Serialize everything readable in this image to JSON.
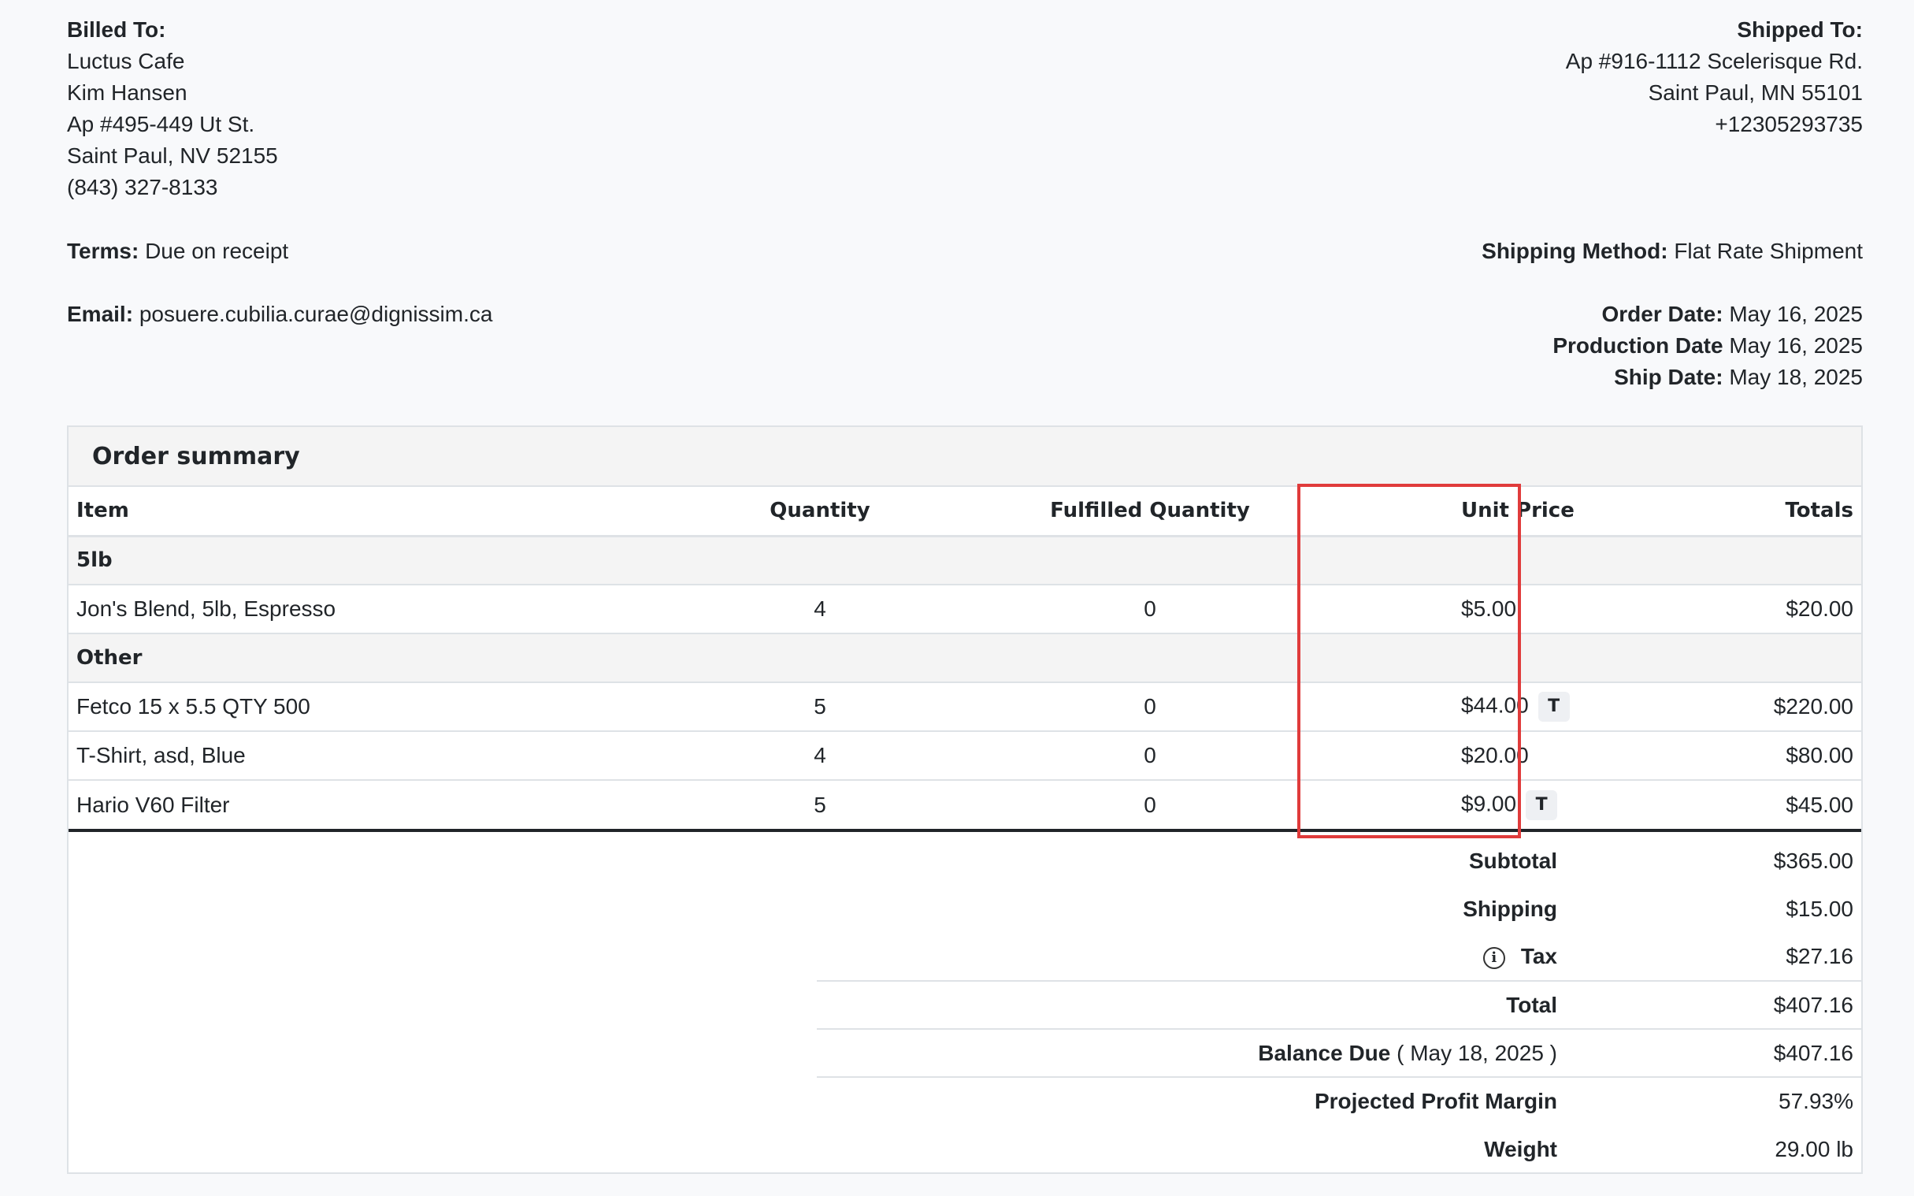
{
  "billed_to": {
    "label": "Billed To:",
    "company": "Luctus Cafe",
    "name": "Kim Hansen",
    "address1": "Ap #495-449 Ut St.",
    "address2": "Saint Paul, NV 52155",
    "phone": "(843) 327-8133"
  },
  "terms": {
    "label": "Terms:",
    "value": "Due on receipt"
  },
  "email": {
    "label": "Email:",
    "value": "posuere.cubilia.curae@dignissim.ca"
  },
  "shipped_to": {
    "label": "Shipped To:",
    "address1": "Ap #916-1112 Scelerisque Rd.",
    "address2": "Saint Paul, MN 55101",
    "phone": "+12305293735"
  },
  "shipping_method": {
    "label": "Shipping Method:",
    "value": "Flat Rate Shipment"
  },
  "dates": {
    "order": {
      "label": "Order Date:",
      "value": "May 16, 2025"
    },
    "production": {
      "label": "Production Date",
      "value": "May 16, 2025"
    },
    "ship": {
      "label": "Ship Date:",
      "value": "May 18, 2025"
    }
  },
  "summary": {
    "title": "Order summary",
    "headers": {
      "item": "Item",
      "quantity": "Quantity",
      "fulfilled": "Fulfilled Quantity",
      "unit_price": "Unit Price",
      "totals": "Totals"
    },
    "groups": [
      {
        "name": "5lb",
        "rows": [
          {
            "item": "Jon's Blend, 5lb, Espresso",
            "quantity": "4",
            "fulfilled": "0",
            "unit_price": "$5.00",
            "taxed": "",
            "total": "$20.00"
          }
        ]
      },
      {
        "name": "Other",
        "rows": [
          {
            "item": "Fetco 15 x 5.5 QTY 500",
            "quantity": "5",
            "fulfilled": "0",
            "unit_price": "$44.00",
            "taxed": "T",
            "total": "$220.00"
          },
          {
            "item": "T-Shirt, asd, Blue",
            "quantity": "4",
            "fulfilled": "0",
            "unit_price": "$20.00",
            "taxed": "",
            "total": "$80.00"
          },
          {
            "item": "Hario V60 Filter",
            "quantity": "5",
            "fulfilled": "0",
            "unit_price": "$9.00",
            "taxed": "T",
            "total": "$45.00"
          }
        ]
      }
    ],
    "totals": {
      "subtotal": {
        "label": "Subtotal",
        "value": "$365.00"
      },
      "shipping": {
        "label": "Shipping",
        "value": "$15.00"
      },
      "tax": {
        "label": "Tax",
        "value": "$27.16"
      },
      "total": {
        "label": "Total",
        "value": "$407.16"
      },
      "balance_due": {
        "label": "Balance Due",
        "date": "( May 18, 2025 )",
        "value": "$407.16"
      },
      "profit_margin": {
        "label": "Projected Profit Margin",
        "value": "57.93%"
      },
      "weight": {
        "label": "Weight",
        "value": "29.00 lb"
      }
    }
  },
  "icons": {
    "info": "info-circle-icon"
  },
  "colors": {
    "highlight": "#e03b3b",
    "group_bg": "#f4f4f4"
  }
}
